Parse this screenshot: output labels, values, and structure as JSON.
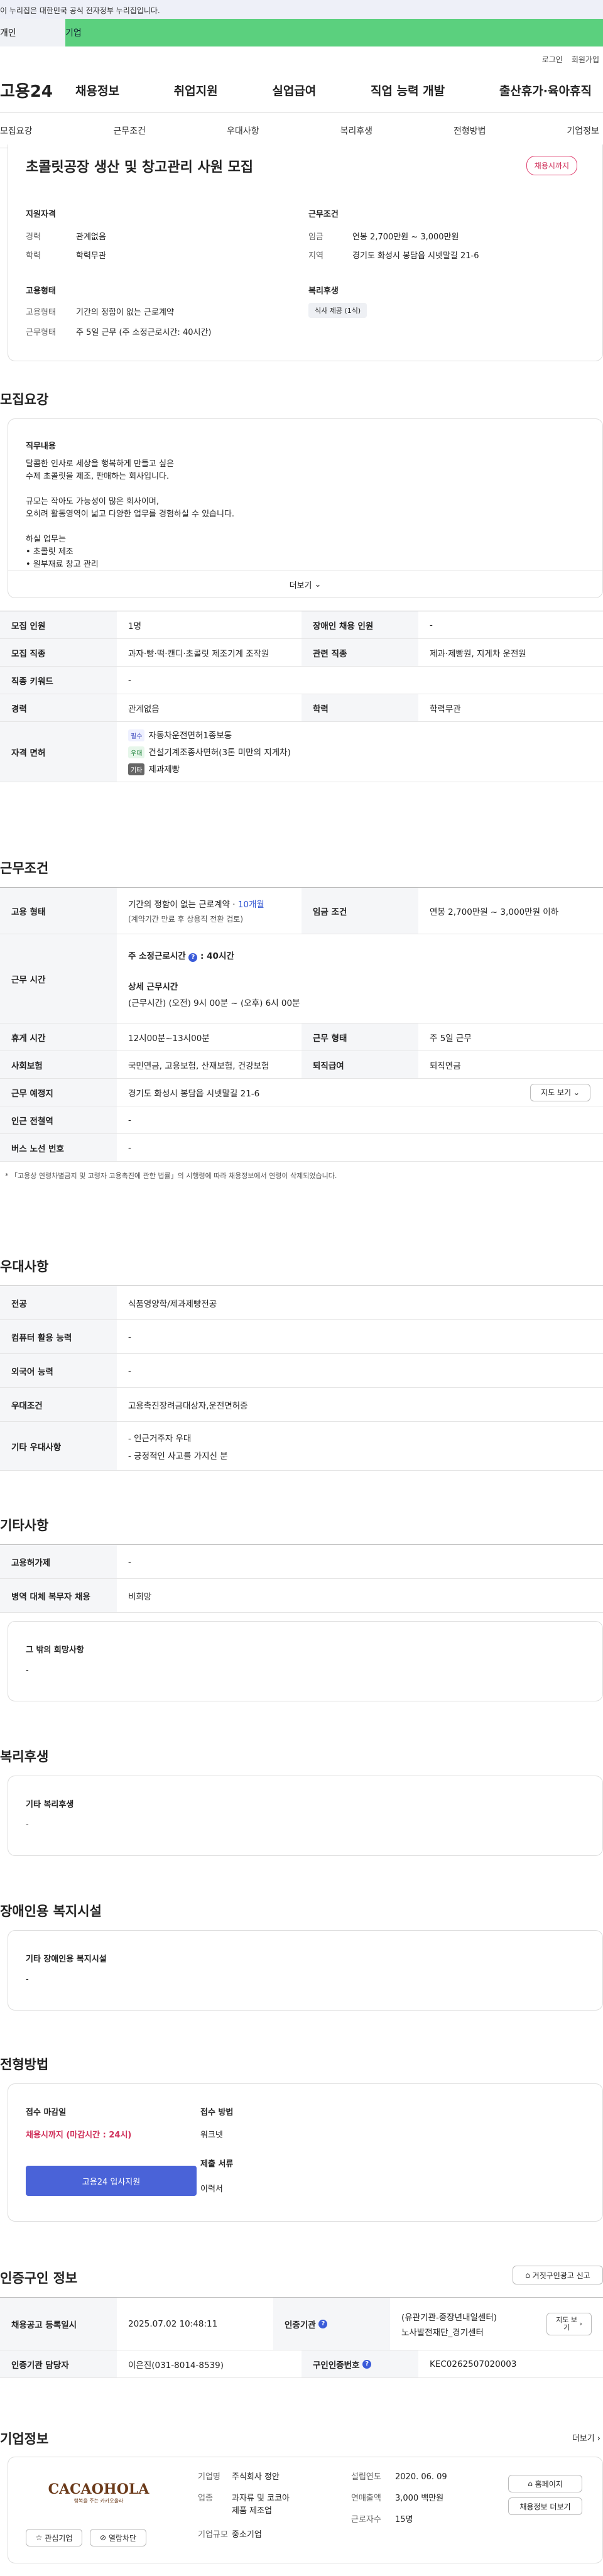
{
  "gov_banner": "이 누리집은 대한민국 공식 전자정부 누리집입니다.",
  "tabs": [
    "개인",
    "기업"
  ],
  "util": [
    "로그인",
    "회원가입"
  ],
  "logo": "고용24",
  "gnb": [
    "채용정보",
    "취업지원",
    "실업급여",
    "직업 능력 개발",
    "출산휴가·육아휴직"
  ],
  "snb": [
    "모집요강",
    "근무조건",
    "우대사항",
    "복리후생",
    "전형방법",
    "기업정보"
  ],
  "job": {
    "title": "초콜릿공장 생산 및 창고관리 사원 모집",
    "status": "채용시까지",
    "req_title": "지원자격",
    "career_label": "경력",
    "career": "관계없음",
    "edu_label": "학력",
    "edu": "학력무관",
    "cond_title": "근무조건",
    "wage_label": "임금",
    "wage": "연봉 2,700만원 ~ 3,000만원",
    "loc_label": "지역",
    "loc": "경기도 화성시 봉담읍 시넷말길 21-6",
    "emp_title": "고용형태",
    "emptype_label": "고용형태",
    "emptype": "기간의 정함이 없는 근로계약",
    "worktype_label": "근무형태",
    "worktype": "주 5일 근무 (주 소정근로시간: 40시간)",
    "welfare_title": "복리후생",
    "welfare_chip": "식사 제공 (1식)"
  },
  "recruit": {
    "title": "모집요강",
    "duty_title": "직무내용",
    "duty": [
      "달콤한 인사로 세상을 행복하게 만들고 싶은",
      "수제 초콜릿을 제조, 판매하는 회사입니다.",
      "",
      "규모는 작아도 가능성이 많은 회사이며,",
      "오히려 활동영역이 넓고 다양한 업무를 경험하실 수 있습니다.",
      "",
      "하실 업무는",
      "• 초콜릿 제조",
      "• 원부재료 창고 관리"
    ],
    "more": "더보기",
    "headcount_label": "모집 인원",
    "headcount": "1명",
    "disabled_label": "장애인 채용 인원",
    "disabled": "-",
    "jobtype_label": "모집 직종",
    "jobtype": "과자·빵·떡·캔디·초콜릿 제조기계 조작원",
    "related_label": "관련 직종",
    "related": "제과·제빵원, 지게차 운전원",
    "keyword_label": "직종 키워드",
    "keyword": "-",
    "career_label": "경력",
    "career": "관계없음",
    "edu_label": "학력",
    "edu": "학력무관",
    "license_label": "자격 면허",
    "licenses": [
      {
        "tag": "필수",
        "name": "자동차운전면허1종보통"
      },
      {
        "tag": "우대",
        "name": "건설기계조종사면허(3톤 미만의 지게차)"
      },
      {
        "tag": "기타",
        "name": "제과제빵"
      }
    ]
  },
  "work": {
    "title": "근무조건",
    "emp_label": "고용 형태",
    "emp1": "기간의 정함이 없는 근로계약 · ",
    "emp_months": "10개월",
    "emp2": "(계약기간 만료 후 상용직 전환 검토)",
    "wage_label": "임금 조건",
    "wage": "연봉 2,700만원 ~ 3,000만원 이하",
    "hours_label": "근무 시간",
    "hours_title": "주 소정근로시간",
    "hours": "40시간",
    "hours_detail_title": "상세 근무시간",
    "hours_detail": "(근무시간) (오전) 9시 00분 ~ (오후) 6시 00분",
    "rest_label": "휴게 시간",
    "rest": "12시00분~13시00분",
    "form_label": "근무 형태",
    "form": "주 5일 근무",
    "ins_label": "사회보험",
    "ins": "국민연금, 고용보험, 산재보험, 건강보험",
    "sev_label": "퇴직급여",
    "sev": "퇴직연금",
    "place_label": "근무 예정지",
    "place": "경기도 화성시 봉담읍 시넷말길 21-6",
    "map": "지도 보기",
    "subway_label": "인근 전철역",
    "subway": "-",
    "bus_label": "버스 노선 번호",
    "bus": "-",
    "note": "「고용상 연령차별금지 및 고령자 고용촉진에 관한 법률」의 시행령에 따라 채용정보에서 연령이 삭제되었습니다."
  },
  "pref": {
    "title": "우대사항",
    "major_label": "전공",
    "major": "식품영양학/제과제빵전공",
    "pc_label": "컴퓨터 활용 능력",
    "pc": "-",
    "lang_label": "외국어 능력",
    "lang": "-",
    "cond_label": "우대조건",
    "cond": "고용촉진장려금대상자,운전면허증",
    "etc_label": "기타 우대사항",
    "etc": [
      "- 인근거주자 우대",
      "- 긍정적인 사고를 가지신 분"
    ]
  },
  "other": {
    "title": "기타사항",
    "ins_label": "고용허가제",
    "ins": "-",
    "mil_label": "병역 대체 복무자 채용",
    "mil": "비희망",
    "hope_title": "그 밖의 희망사항",
    "hope": "-"
  },
  "welfare": {
    "title": "복리후생",
    "card_title": "기타 복리후생",
    "card_val": "-"
  },
  "disab": {
    "title": "장애인용 복지시설",
    "card_title": "기타 장애인용 복지시설",
    "card_val": "-"
  },
  "select": {
    "title": "전형방법",
    "deadline_title": "접수 마감일",
    "deadline": "채용시까지 (마감시간 : 24시)",
    "apply": "고용24 입사지원",
    "method_title": "접수 방법",
    "method": "워크넷",
    "doc_title": "제출 서류",
    "doc": "이력서"
  },
  "cert": {
    "title": "인증구인 정보",
    "report": "거짓구인광고 신고",
    "reg_label": "채용공고 등록일시",
    "reg": "2025.07.02 10:48:11",
    "org_label": "인증기관",
    "org1": "(유관기관-중장년내일센터)",
    "org2": "노사발전재단_경기센터",
    "org_btn": "지도 보기",
    "mgr_label": "인증기관 담당자",
    "mgr": "이은진(031-8014-8539)",
    "num_label": "구인인증번호",
    "num": "KEC0262507020003"
  },
  "company": {
    "title": "기업정보",
    "more": "더보기",
    "logo": "CACAOHOLA",
    "tagline": "행복을 주는 카카오올라",
    "fav": "관심기업",
    "block": "열람차단",
    "industry_label": "기업명",
    "industry": "주식회사 정안",
    "sector_label": "업종",
    "sector1": "과자류 및 코코아",
    "sector2": "제품 제조업",
    "size_label": "기업규모",
    "size": "중소기업",
    "year_label": "설립연도",
    "year": "2020. 06. 09",
    "sales_label": "연매출액",
    "sales": "3,000 백만원",
    "emp_label": "근로자수",
    "emp": "15명",
    "home": "홈페이지",
    "jobs": "채용정보 더보기"
  }
}
